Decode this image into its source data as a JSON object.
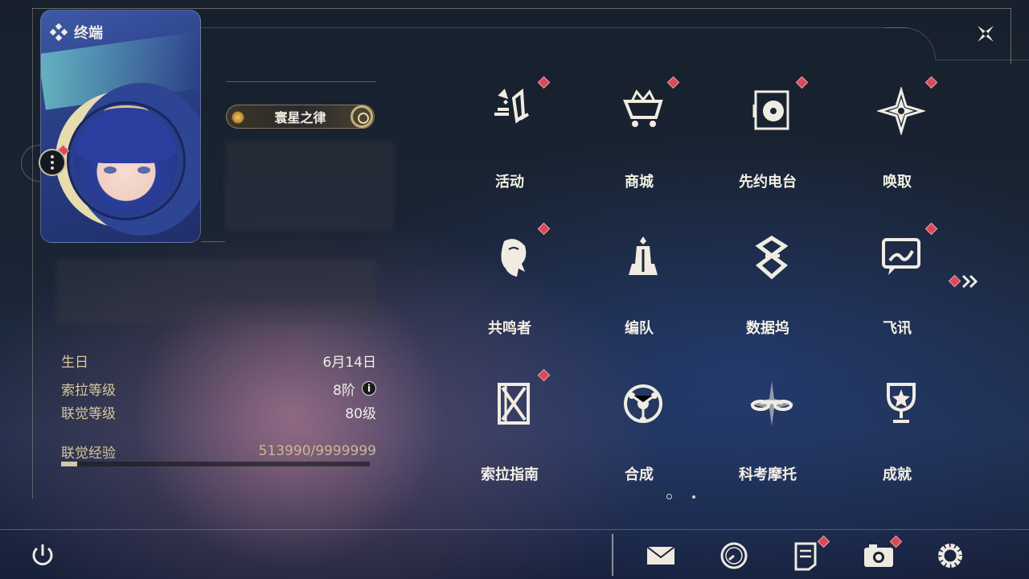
{
  "header": {
    "title": "终端"
  },
  "profile": {
    "title_badge": "寰星之律",
    "rows": [
      {
        "label": "生日",
        "value": "6月14日"
      },
      {
        "label": "索拉等级",
        "value": "8阶"
      },
      {
        "label": "联觉等级",
        "value": "80级"
      }
    ],
    "info_icon": "i",
    "exp": {
      "label": "联觉经验",
      "value": "513990/9999999",
      "fraction": 0.0514
    }
  },
  "menu": {
    "items": [
      {
        "label": "活动",
        "icon": "activity-icon",
        "badge": true
      },
      {
        "label": "商城",
        "icon": "shop-icon",
        "badge": true
      },
      {
        "label": "先约电台",
        "icon": "radio-icon",
        "badge": true
      },
      {
        "label": "唤取",
        "icon": "summon-icon",
        "badge": true
      },
      {
        "label": "共鸣者",
        "icon": "resonator-icon",
        "badge": true
      },
      {
        "label": "编队",
        "icon": "team-icon",
        "badge": false
      },
      {
        "label": "数据坞",
        "icon": "data-dock-icon",
        "badge": false
      },
      {
        "label": "飞讯",
        "icon": "message-icon",
        "badge": true
      },
      {
        "label": "索拉指南",
        "icon": "guide-icon",
        "badge": true
      },
      {
        "label": "合成",
        "icon": "synthesis-icon",
        "badge": false
      },
      {
        "label": "科考摩托",
        "icon": "motorcycle-icon",
        "badge": false
      },
      {
        "label": "成就",
        "icon": "achievement-icon",
        "badge": false
      }
    ],
    "page": {
      "current": 1,
      "total": 2
    }
  },
  "bottom_bar": {
    "buttons": [
      {
        "name": "power-icon"
      },
      {
        "name": "mail-icon"
      },
      {
        "name": "clock-icon"
      },
      {
        "name": "notes-icon"
      },
      {
        "name": "camera-icon"
      },
      {
        "name": "settings-icon"
      }
    ]
  },
  "colors": {
    "accent_gold": "#d6c79c",
    "badge_red": "#d84a5a",
    "text": "#f4f0e6"
  }
}
